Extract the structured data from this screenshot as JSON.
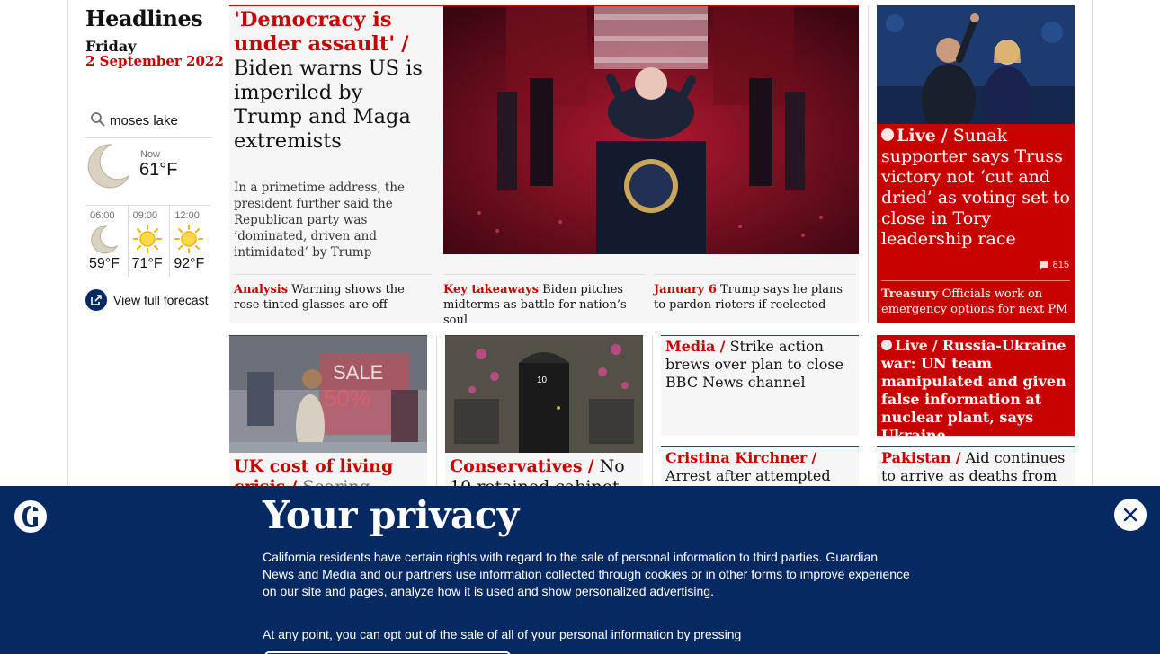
{
  "colors": {
    "accent": "#c70000",
    "banner": "#052962",
    "card_bg": "#f6f6f6"
  },
  "sidebar": {
    "title": "Headlines",
    "day": "Friday",
    "date": "2 September 2022",
    "weather": {
      "location": "moses lake",
      "now_label": "Now",
      "now_temp": "61°F",
      "now_icon": "moon-icon",
      "forecast": [
        {
          "time": "06:00",
          "temp": "59°F",
          "icon": "moon-icon"
        },
        {
          "time": "09:00",
          "temp": "71°F",
          "icon": "sun-icon"
        },
        {
          "time": "12:00",
          "temp": "92°F",
          "icon": "sun-icon"
        }
      ],
      "full_forecast_label": "View full forecast"
    }
  },
  "lead": {
    "kicker": "'Democracy is under assault'",
    "separator": "/",
    "headline": "Biden warns US is imperiled by Trump and Maga extremists",
    "standfirst": "In a primetime address, the president further said the Republican party was ‘dominated, driven and intimidated’ by Trump",
    "subs": [
      {
        "kicker": "Analysis",
        "text": "Warning shows the rose-tinted glasses are off"
      },
      {
        "kicker": "Key takeaways",
        "text": "Biden pitches midterms as battle for nation’s soul"
      },
      {
        "kicker": "January 6",
        "text": "Trump says he plans to pardon rioters if reelected"
      }
    ]
  },
  "right_top": {
    "kicker": "Live",
    "separator": "/",
    "headline": "Sunak supporter says Truss victory not ‘cut and dried’ as voting set to close in Tory leadership race",
    "comments": "815",
    "sub_kicker": "Treasury",
    "sub_text": "Officials work on emergency options for next PM"
  },
  "row2": [
    {
      "kicker": "UK cost of living crisis",
      "separator": "/",
      "headline": "Soaring prices could"
    },
    {
      "kicker": "Conservatives",
      "separator": "/",
      "headline": "No 10 retained cabinet"
    }
  ],
  "row2_right": [
    {
      "kicker": "Media",
      "separator": "/",
      "headline": "Strike action brews over plan to close BBC News channel"
    },
    {
      "kicker": "Cristina Kirchner",
      "separator": "/",
      "headline": "Arrest after attempted shooting"
    }
  ],
  "row2_far": [
    {
      "kicker": "Live",
      "separator": "/",
      "headline": "Russia-Ukraine war: UN team manipulated and given false information at nuclear plant, says Ukraine"
    },
    {
      "kicker": "Pakistan",
      "separator": "/",
      "headline": "Aid continues to arrive as deaths from"
    }
  ],
  "privacy": {
    "title": "Your privacy",
    "body": "California residents have certain rights with regard to the sale of personal information to third parties. Guardian News and Media and our partners use information collected through cookies or in other forms to improve experience on our site and pages, analyze how it is used and show personalized advertising.",
    "body2": "At any point, you can opt out of the sale of all of your personal information by pressing"
  }
}
